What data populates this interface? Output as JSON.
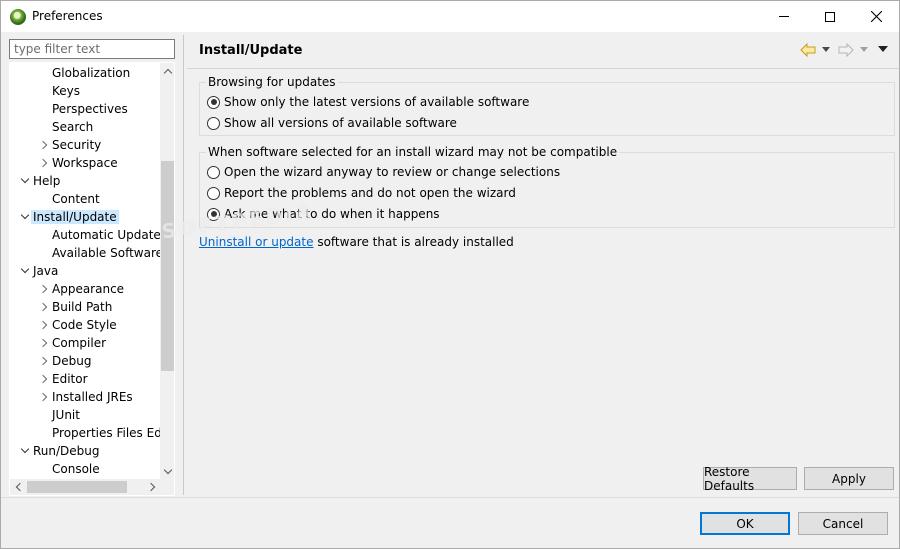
{
  "window": {
    "title": "Preferences"
  },
  "filter": {
    "placeholder": "type filter text"
  },
  "tree": {
    "items": [
      {
        "label": "Globalization",
        "level": 2,
        "twisty": "none"
      },
      {
        "label": "Keys",
        "level": 2,
        "twisty": "none"
      },
      {
        "label": "Perspectives",
        "level": 2,
        "twisty": "none"
      },
      {
        "label": "Search",
        "level": 2,
        "twisty": "none"
      },
      {
        "label": "Security",
        "level": 2,
        "twisty": "collapsed"
      },
      {
        "label": "Workspace",
        "level": 2,
        "twisty": "collapsed"
      },
      {
        "label": "Help",
        "level": 1,
        "twisty": "expanded"
      },
      {
        "label": "Content",
        "level": 2,
        "twisty": "none"
      },
      {
        "label": "Install/Update",
        "level": 1,
        "twisty": "expanded",
        "selected": true
      },
      {
        "label": "Automatic Updates",
        "level": 2,
        "twisty": "none"
      },
      {
        "label": "Available Software S",
        "level": 2,
        "twisty": "none"
      },
      {
        "label": "Java",
        "level": 1,
        "twisty": "expanded"
      },
      {
        "label": "Appearance",
        "level": 2,
        "twisty": "collapsed"
      },
      {
        "label": "Build Path",
        "level": 2,
        "twisty": "collapsed"
      },
      {
        "label": "Code Style",
        "level": 2,
        "twisty": "collapsed"
      },
      {
        "label": "Compiler",
        "level": 2,
        "twisty": "collapsed"
      },
      {
        "label": "Debug",
        "level": 2,
        "twisty": "collapsed"
      },
      {
        "label": "Editor",
        "level": 2,
        "twisty": "collapsed"
      },
      {
        "label": "Installed JREs",
        "level": 2,
        "twisty": "collapsed"
      },
      {
        "label": "JUnit",
        "level": 2,
        "twisty": "none"
      },
      {
        "label": "Properties Files Edito",
        "level": 2,
        "twisty": "none"
      },
      {
        "label": "Run/Debug",
        "level": 1,
        "twisty": "expanded"
      },
      {
        "label": "Console",
        "level": 2,
        "twisty": "none"
      }
    ]
  },
  "page": {
    "title": "Install/Update",
    "browsing_group": {
      "legend": "Browsing for updates",
      "options": [
        {
          "label": "Show only the latest versions of available software",
          "checked": true
        },
        {
          "label": "Show all versions of available software",
          "checked": false
        }
      ]
    },
    "compat_group": {
      "legend": "When software selected for an install wizard may not be compatible",
      "options": [
        {
          "label": "Open the wizard anyway to review or change selections",
          "checked": false
        },
        {
          "label": "Report the problems and do not open the wizard",
          "checked": false
        },
        {
          "label": "Ask me what to do when it happens",
          "checked": true
        }
      ]
    },
    "link_text": "Uninstall or update",
    "link_suffix": " software that is already installed"
  },
  "buttons": {
    "restore": "Restore Defaults",
    "apply": "Apply",
    "ok": "OK",
    "cancel": "Cancel"
  },
  "watermark": "SOFTPEDIA",
  "colors": {
    "selection": "#cce8ff",
    "link": "#0066cc",
    "default_button_border": "#0078d7"
  }
}
